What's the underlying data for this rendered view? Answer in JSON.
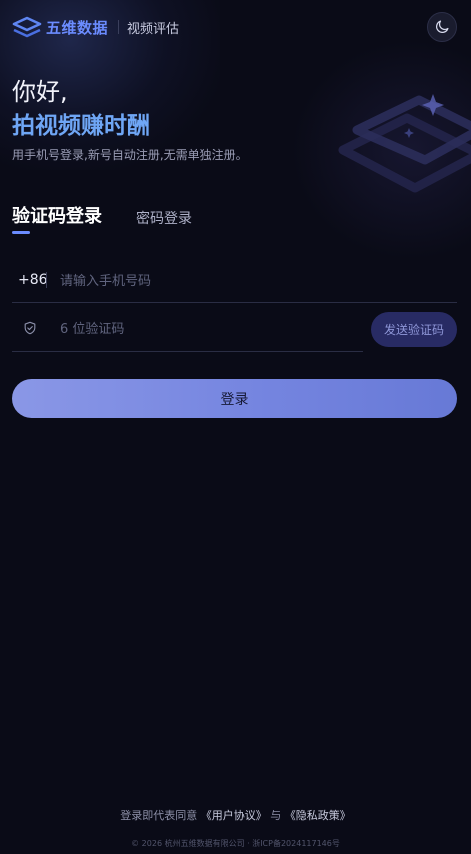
{
  "header": {
    "brand": "五维数据",
    "product": "视频评估",
    "theme_icon": "moon-icon"
  },
  "hero": {
    "greeting": "你好,",
    "slogan": "拍视频赚时酬",
    "subtitle": "用手机号登录,新号自动注册,无需单独注册。"
  },
  "tabs": {
    "active": "验证码登录",
    "inactive": "密码登录"
  },
  "form": {
    "phone_prefix": "+86",
    "phone_placeholder": "请输入手机号码",
    "phone_value": "",
    "code_placeholder": "6 位验证码",
    "code_value": "",
    "code_icon": "shield-check-icon",
    "send_code_label": "发送验证码",
    "login_label": "登录"
  },
  "footer": {
    "agree_prefix": "登录即代表同意",
    "user_agreement": "《用户协议》",
    "connector": "与",
    "privacy_policy": "《隐私政策》",
    "copyright": "© 2026 杭州五维数据有限公司 · 浙ICP备2024117146号"
  },
  "colors": {
    "background": "#0a0b17",
    "brand_blue": "#6b8cff",
    "slogan_blue": "#6fa6f5",
    "send_button_bg": "#282b64",
    "login_gradient_start": "#8a97e6",
    "login_gradient_end": "#6779d6"
  }
}
